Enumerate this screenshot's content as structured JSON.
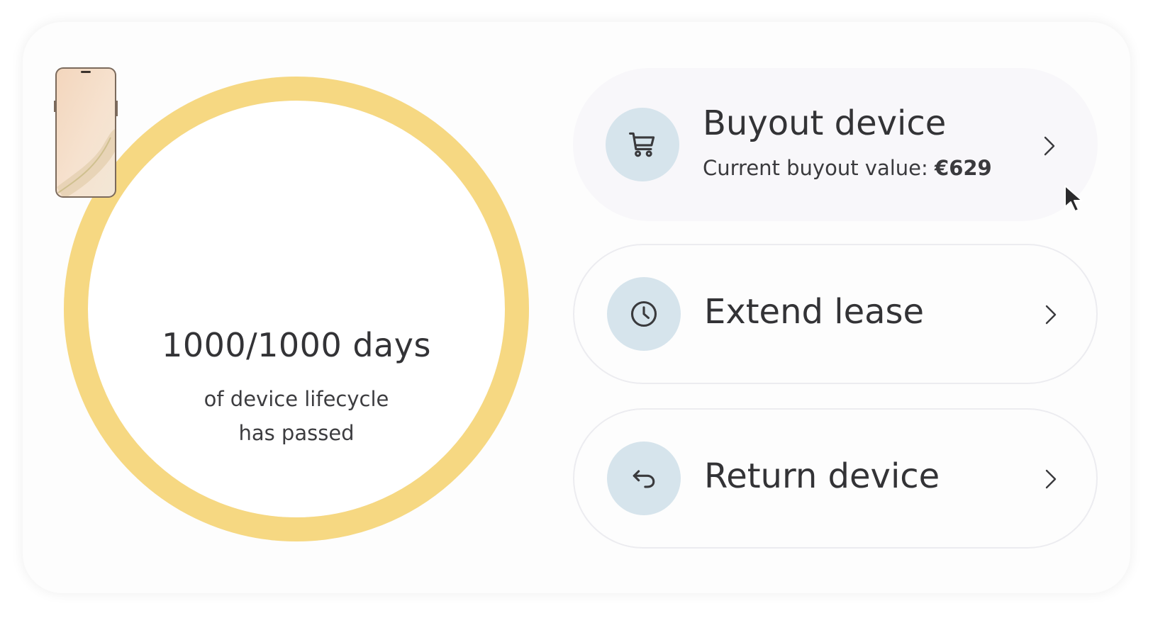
{
  "lifecycle": {
    "days_passed": 1000,
    "days_total": 1000,
    "progress": 1.0,
    "days_text": "1000/1000 days",
    "caption_line1": "of device lifecycle",
    "caption_line2": "has passed",
    "ring_color": "#f6d882"
  },
  "actions": [
    {
      "title": "Buyout device",
      "subtitle_prefix": "Current buyout value: ",
      "subtitle_value": "€629",
      "icon": "shopping-cart-icon",
      "state": "hovered"
    },
    {
      "title": "Extend lease",
      "icon": "clock-icon"
    },
    {
      "title": "Return device",
      "icon": "return-arrow-icon"
    }
  ],
  "colors": {
    "icon_circle": "#d6e4ec",
    "text": "#333336"
  }
}
